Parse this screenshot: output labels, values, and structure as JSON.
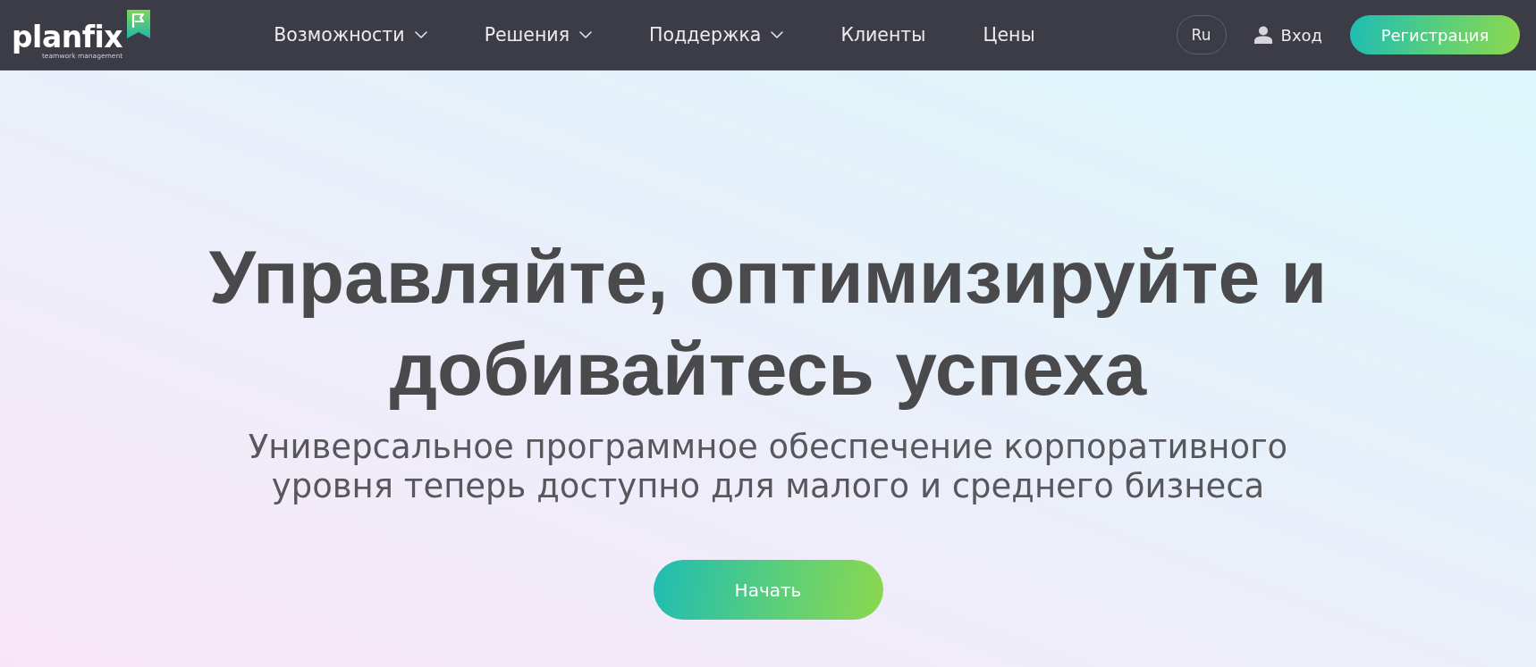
{
  "header": {
    "logo": {
      "name": "planfix",
      "tagline": "teamwork management"
    },
    "nav": [
      {
        "label": "Возможности",
        "dropdown": true
      },
      {
        "label": "Решения",
        "dropdown": true
      },
      {
        "label": "Поддержка",
        "dropdown": true
      },
      {
        "label": "Клиенты",
        "dropdown": false
      },
      {
        "label": "Цены",
        "dropdown": false
      }
    ],
    "language": "Ru",
    "login": "Вход",
    "register": "Регистрация"
  },
  "hero": {
    "title": "Управляйте, оптимизируйте и добивайтесь успеха",
    "subtitle": "Универсальное программное обеспечение корпоративного уровня теперь доступно для малого и среднего бизнеса",
    "cta": "Начать"
  }
}
